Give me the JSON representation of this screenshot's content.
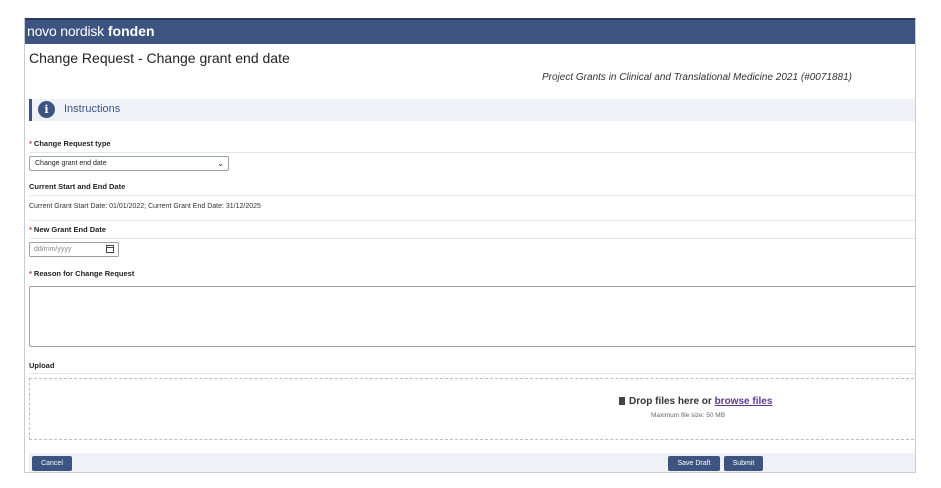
{
  "brand": {
    "light": "novo nordisk",
    "bold": "fonden"
  },
  "page": {
    "title": "Change Request - Change grant end date",
    "grant_name": "Project Grants in Clinical and Translational Medicine 2021 (#0071881)"
  },
  "instructions": {
    "label": "Instructions",
    "icon": "info-icon"
  },
  "form": {
    "required_marker": "*",
    "change_type": {
      "label": "Change Request type",
      "selected": "Change grant end date"
    },
    "current_dates": {
      "label": "Current Start and End Date",
      "value": "Current Grant Start Date: 01/01/2022; Current Grant End Date: 31/12/2025"
    },
    "new_end_date": {
      "label": "New Grant End Date",
      "placeholder": "dd/mm/yyyy"
    },
    "reason": {
      "label": "Reason for Change Request",
      "value": ""
    },
    "upload": {
      "label": "Upload",
      "drop_text": "Drop files here or ",
      "browse_link": "browse files",
      "max_size": "Maximum file size: 50 MB"
    }
  },
  "buttons": {
    "cancel": "Cancel",
    "save_draft": "Save Draft",
    "submit": "Submit"
  },
  "colors": {
    "brand": "#3e5480",
    "required": "#c0392b",
    "link": "#5b3a8e",
    "panel": "#eef1f5"
  }
}
